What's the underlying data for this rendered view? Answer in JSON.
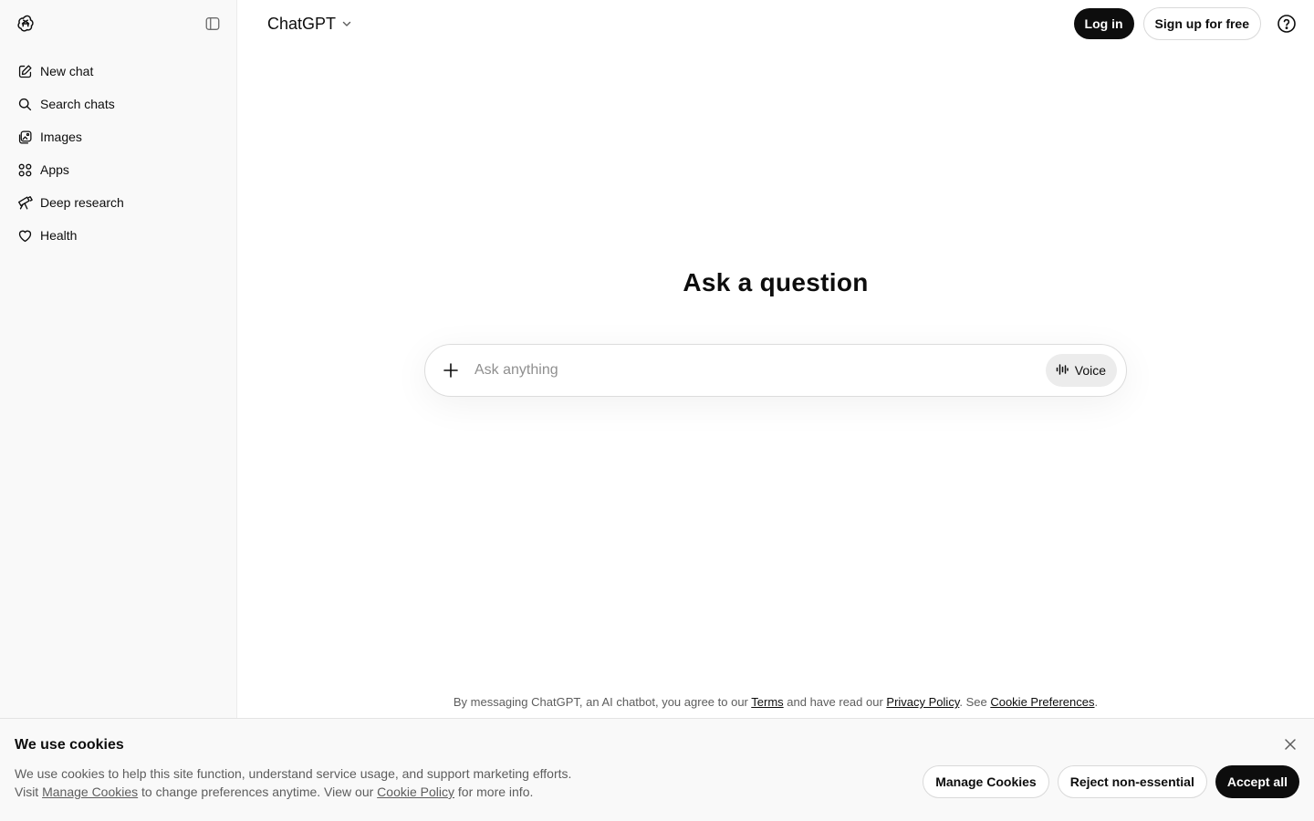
{
  "sidebar": {
    "logo_icon": "openai-logo-icon",
    "toggle_icon": "sidebar-toggle-icon",
    "items": [
      {
        "label": "New chat",
        "icon": "edit-icon"
      },
      {
        "label": "Search chats",
        "icon": "search-icon"
      },
      {
        "label": "Images",
        "icon": "images-icon"
      },
      {
        "label": "Apps",
        "icon": "apps-grid-icon"
      },
      {
        "label": "Deep research",
        "icon": "telescope-icon"
      },
      {
        "label": "Health",
        "icon": "heart-icon"
      }
    ]
  },
  "header": {
    "model_label": "ChatGPT",
    "login_label": "Log in",
    "signup_label": "Sign up for free",
    "help_icon": "help-icon"
  },
  "main": {
    "title": "Ask a question",
    "composer": {
      "placeholder": "Ask anything",
      "voice_label": "Voice"
    },
    "disclaimer": {
      "prefix": "By messaging ChatGPT, an AI chatbot, you agree to our ",
      "terms": "Terms",
      "middle": " and have read our ",
      "privacy": "Privacy Policy",
      "see": ". See ",
      "cookie_prefs": "Cookie Preferences",
      "suffix": "."
    }
  },
  "cookie_banner": {
    "title": "We use cookies",
    "line1": "We use cookies to help this site function, understand service usage, and support marketing efforts.",
    "line2_prefix": "Visit ",
    "manage_link": "Manage Cookies",
    "line2_middle": " to change preferences anytime. View our ",
    "policy_link": "Cookie Policy",
    "line2_suffix": " for more info.",
    "manage_button": "Manage Cookies",
    "reject_button": "Reject non-essential",
    "accept_button": "Accept all"
  },
  "colors": {
    "sidebar_bg": "#f9f9f9",
    "primary_dark": "#0d0d0d",
    "muted_text": "#5d5d5d",
    "border": "#d9d9d9"
  }
}
